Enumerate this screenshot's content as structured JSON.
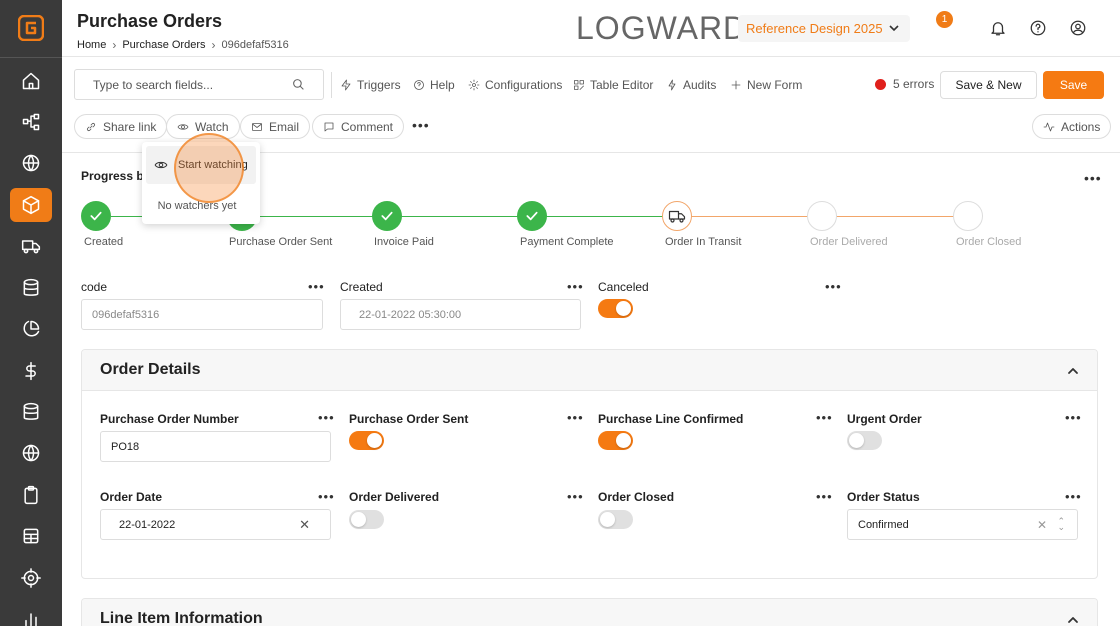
{
  "header": {
    "title": "Purchase Orders",
    "breadcrumb": [
      "Home",
      "Purchase Orders",
      "096defaf5316"
    ],
    "brand": "LOGWARD",
    "reference_select": "Reference Design 2025",
    "notification_count": "1"
  },
  "toolbar": {
    "search_placeholder": "Type to search fields...",
    "triggers": "Triggers",
    "help": "Help",
    "configurations": "Configurations",
    "table_editor": "Table Editor",
    "audits": "Audits",
    "new_form": "New Form",
    "errors": "5 errors",
    "save_new": "Save & New",
    "save": "Save"
  },
  "actions_row": {
    "share_link": "Share link",
    "watch": "Watch",
    "email": "Email",
    "comment": "Comment",
    "actions": "Actions"
  },
  "watch_popover": {
    "start_watching": "Start watching",
    "empty": "No watchers yet"
  },
  "progress": {
    "label": "Progress ba",
    "steps": [
      {
        "label": "Created",
        "state": "done"
      },
      {
        "label": "Purchase Order Sent",
        "state": "done"
      },
      {
        "label": "Invoice Paid",
        "state": "done"
      },
      {
        "label": "Payment Complete",
        "state": "done"
      },
      {
        "label": "Order In Transit",
        "state": "current"
      },
      {
        "label": "Order Delivered",
        "state": "todo"
      },
      {
        "label": "Order Closed",
        "state": "todo"
      }
    ]
  },
  "top_fields": {
    "code_label": "code",
    "code_value": "096defaf5316",
    "created_label": "Created",
    "created_value": "22-01-2022 05:30:00",
    "canceled_label": "Canceled",
    "canceled_on": true
  },
  "order_details": {
    "title": "Order Details",
    "po_number_label": "Purchase Order Number",
    "po_number_value": "PO18",
    "po_sent_label": "Purchase Order Sent",
    "po_sent_on": true,
    "line_confirmed_label": "Purchase Line Confirmed",
    "line_confirmed_on": true,
    "urgent_label": "Urgent Order",
    "urgent_on": false,
    "order_date_label": "Order Date",
    "order_date_value": "22-01-2022",
    "delivered_label": "Order Delivered",
    "delivered_on": false,
    "closed_label": "Order Closed",
    "closed_on": false,
    "status_label": "Order Status",
    "status_value": "Confirmed"
  },
  "line_items": {
    "title": "Line Item Information"
  },
  "colors": {
    "accent": "#f57a12",
    "success": "#3cb54a",
    "error": "#e0201c",
    "sidebar": "#3a3a3a"
  }
}
